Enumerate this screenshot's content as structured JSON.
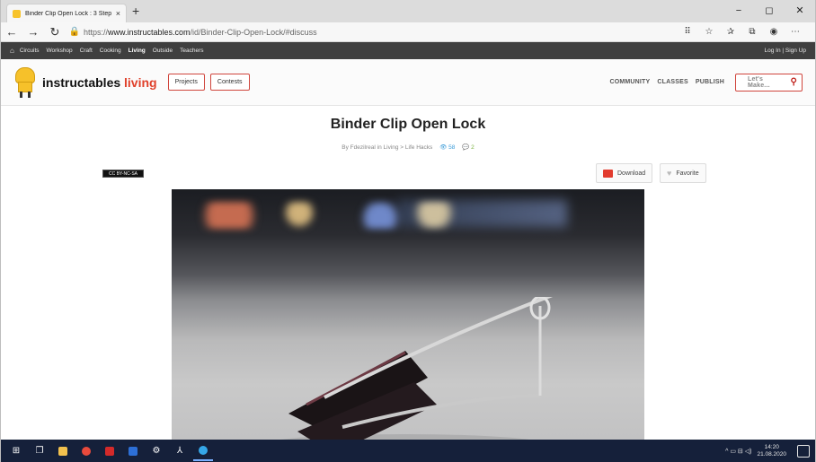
{
  "browser": {
    "tab_title": "Binder Clip Open Lock : 3 Steps",
    "tab_close": "×",
    "new_tab": "+",
    "url_prefix": "https://",
    "url_domain": "www.instructables.com",
    "url_path": "/id/Binder-Clip-Open-Lock/#discuss",
    "controls": {
      "minimize": "−",
      "maximize": "◻",
      "close": "✕"
    },
    "nav": {
      "back": "←",
      "forward": "→",
      "refresh": "↻",
      "lock": "🔒"
    },
    "toolbar_icons": [
      "⠿",
      "☆",
      "✰",
      "⧉",
      "◉",
      "⋯"
    ]
  },
  "site": {
    "topstrip": {
      "categories": [
        "Circuits",
        "Workshop",
        "Craft",
        "Cooking",
        "Living",
        "Outside",
        "Teachers"
      ],
      "active_category": "Living",
      "auth": "Log In | Sign Up"
    },
    "header": {
      "brand_main": "instructables",
      "brand_accent": "living",
      "projects_label": "Projects",
      "contests_label": "Contests",
      "nav": [
        "COMMUNITY",
        "CLASSES",
        "PUBLISH"
      ],
      "search_placeholder": "Let's Make..."
    }
  },
  "article": {
    "title": "Binder Clip Open Lock",
    "by_prefix": "By",
    "author": "Fdezilreal",
    "in_label": "in",
    "category": "Living",
    "subcategory": "Life Hacks",
    "views": "58",
    "comments": "2",
    "license_badge": "CC BY-NC-SA",
    "download_label": "Download",
    "favorite_label": "Favorite"
  },
  "taskbar": {
    "time": "14:20",
    "date": "21.08.2020",
    "tray_icons": "^  ▭  ⊟  ◁)"
  },
  "colors": {
    "brand_red": "#e0412b",
    "topstrip_bg": "#3f3f3f",
    "taskbar_bg": "#15203a"
  }
}
